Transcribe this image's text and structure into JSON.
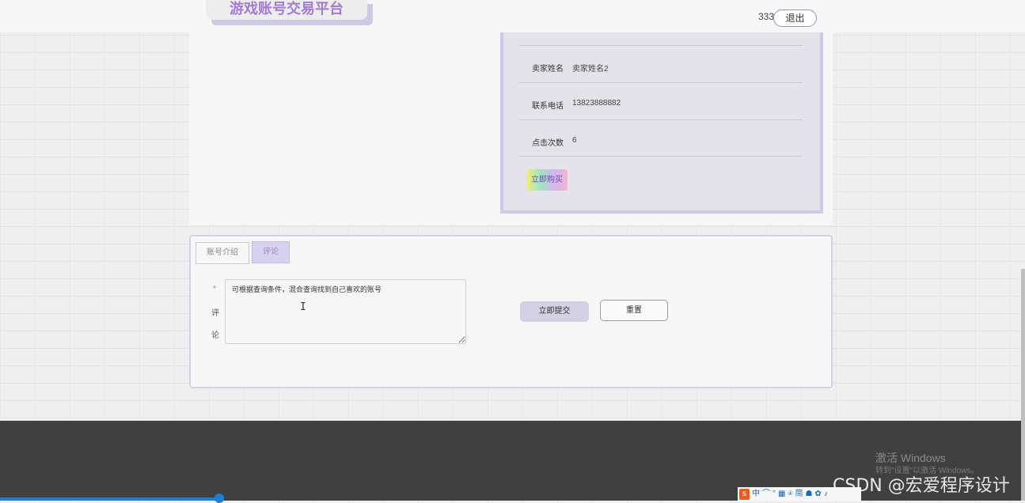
{
  "header": {
    "site_title": "游戏账号交易平台",
    "username": "333",
    "logout_label": "退出"
  },
  "details": {
    "rows": [
      {
        "label": "卖家姓名",
        "value": "卖家姓名2"
      },
      {
        "label": "联系电话",
        "value": "13823888882"
      },
      {
        "label": "点击次数",
        "value": "6"
      }
    ],
    "buy_label": "立即购买"
  },
  "tabs": [
    {
      "label": "账号介绍",
      "active": false
    },
    {
      "label": "评论",
      "active": true
    }
  ],
  "comment_form": {
    "required_mark": "*",
    "label_chars": [
      "评",
      "论"
    ],
    "textarea_value": "可根据查询条件，混合查询找到自己喜欢的账号",
    "submit_label": "立即提交",
    "reset_label": "重置"
  },
  "watermark": {
    "line1": "激活 Windows",
    "line2": "转到\"设置\"以激活 Windows。",
    "csdn": "CSDN @宏爱程序设计"
  },
  "ime_toolbar": {
    "items": [
      "中",
      "⌒",
      "°",
      "▦",
      "⍟",
      "简",
      "☗",
      "✿",
      "♪"
    ]
  }
}
